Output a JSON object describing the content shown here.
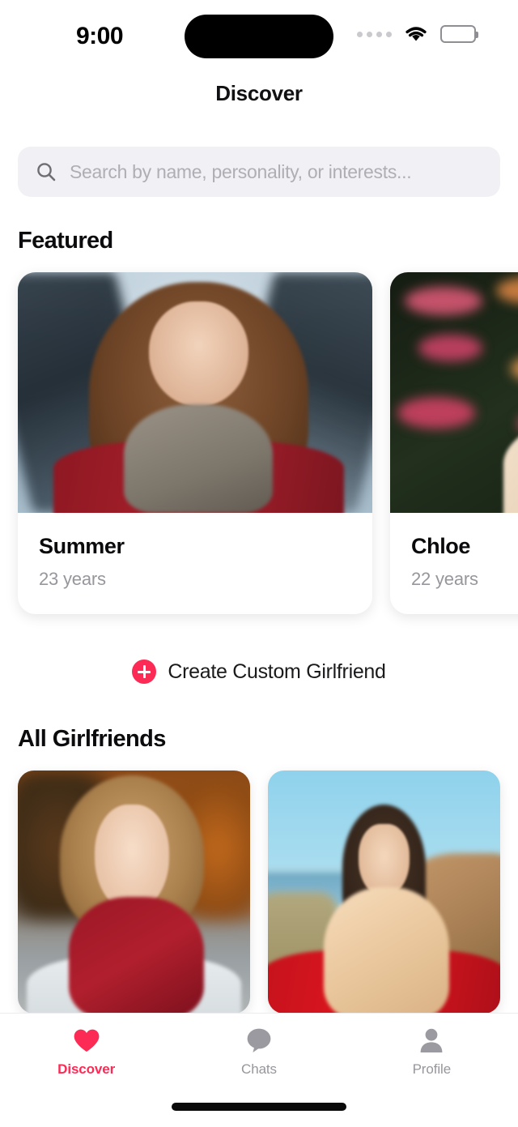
{
  "status_bar": {
    "time": "9:00",
    "signal_icon": "signal-dots-icon",
    "wifi_icon": "wifi-icon",
    "battery_icon": "battery-icon"
  },
  "header": {
    "title": "Discover"
  },
  "search": {
    "icon": "search-icon",
    "placeholder": "Search by name, personality, or interests...",
    "value": ""
  },
  "featured": {
    "title": "Featured",
    "cards": [
      {
        "name": "Summer",
        "age": "23 years"
      },
      {
        "name": "Chloe",
        "age": "22 years"
      }
    ]
  },
  "create_cta": {
    "icon": "plus-circle-icon",
    "label": "Create Custom Girlfriend"
  },
  "all_girlfriends": {
    "title": "All Girlfriends",
    "cards": [
      {
        "photo": "autumn-portrait"
      },
      {
        "photo": "coast-portrait"
      }
    ]
  },
  "tab_bar": {
    "tabs": [
      {
        "label": "Discover",
        "icon": "heart-icon",
        "active": true
      },
      {
        "label": "Chats",
        "icon": "chat-bubble-icon",
        "active": false
      },
      {
        "label": "Profile",
        "icon": "person-icon",
        "active": false
      }
    ]
  },
  "colors": {
    "accent": "#FC2B55",
    "text_primary": "#0B0B0C",
    "text_secondary": "#96969C",
    "search_background": "#F1F1F5"
  }
}
